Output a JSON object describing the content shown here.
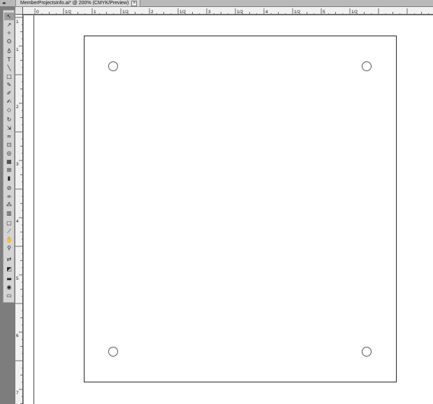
{
  "window": {
    "document_tab_label": "MemberProjectsInfo.ai* @ 200% (CMYK/Preview)",
    "close_glyph": "×"
  },
  "rulers": {
    "top_labels": [
      "0",
      "1/2",
      "1",
      "1/2",
      "2",
      "1/2",
      "3",
      "1/2",
      "4",
      "1/2",
      "5",
      "1/2"
    ],
    "left_labels": [
      "1",
      "1",
      "2",
      "3",
      "4",
      "5",
      "6",
      "7"
    ]
  },
  "toolbar": {
    "tools": [
      {
        "name": "selection-tool-icon",
        "glyph": "↖"
      },
      {
        "name": "direct-selection-tool-icon",
        "glyph": "↗"
      },
      {
        "name": "magic-wand-tool-icon",
        "glyph": "✧"
      },
      {
        "name": "lasso-tool-icon",
        "glyph": "ʘ"
      },
      {
        "name": "pen-tool-icon",
        "glyph": "♁"
      },
      {
        "name": "type-tool-icon",
        "glyph": "T"
      },
      {
        "name": "line-tool-icon",
        "glyph": "╲"
      },
      {
        "name": "rectangle-tool-icon",
        "glyph": "□"
      },
      {
        "name": "paintbrush-tool-icon",
        "glyph": "✎"
      },
      {
        "name": "pencil-tool-icon",
        "glyph": "✐"
      },
      {
        "name": "blob-brush-tool-icon",
        "glyph": "✍"
      },
      {
        "name": "eraser-tool-icon",
        "glyph": "◇"
      },
      {
        "name": "rotate-tool-icon",
        "glyph": "↻"
      },
      {
        "name": "scale-tool-icon",
        "glyph": "⇲"
      },
      {
        "name": "warp-tool-icon",
        "glyph": "≈"
      },
      {
        "name": "free-transform-tool-icon",
        "glyph": "⊡"
      },
      {
        "name": "shape-builder-tool-icon",
        "glyph": "◎"
      },
      {
        "name": "perspective-grid-tool-icon",
        "glyph": "▦"
      },
      {
        "name": "mesh-tool-icon",
        "glyph": "⊞"
      },
      {
        "name": "gradient-tool-icon",
        "glyph": "▮"
      },
      {
        "name": "eyedropper-tool-icon",
        "glyph": "⊘"
      },
      {
        "name": "blend-tool-icon",
        "glyph": "∞"
      },
      {
        "name": "symbol-sprayer-tool-icon",
        "glyph": "⁂"
      },
      {
        "name": "column-graph-tool-icon",
        "glyph": "▥"
      },
      {
        "name": "artboard-tool-icon",
        "glyph": "▢"
      },
      {
        "name": "slice-tool-icon",
        "glyph": "⟋"
      },
      {
        "name": "hand-tool-icon",
        "glyph": "✋"
      },
      {
        "name": "zoom-tool-icon",
        "glyph": "⚲"
      },
      {
        "name": "swap-fill-stroke-icon",
        "glyph": "⇄"
      },
      {
        "name": "fill-stroke-swatch-icon",
        "glyph": "◩"
      },
      {
        "name": "color-mode-icon",
        "glyph": "▬"
      },
      {
        "name": "draw-mode-icon",
        "glyph": "◉"
      },
      {
        "name": "screen-mode-icon",
        "glyph": "▭"
      }
    ]
  },
  "colors": {
    "artboard_stroke": "#222222",
    "hole_stroke": "#555555",
    "workspace_gray": "#8a8a8a"
  }
}
